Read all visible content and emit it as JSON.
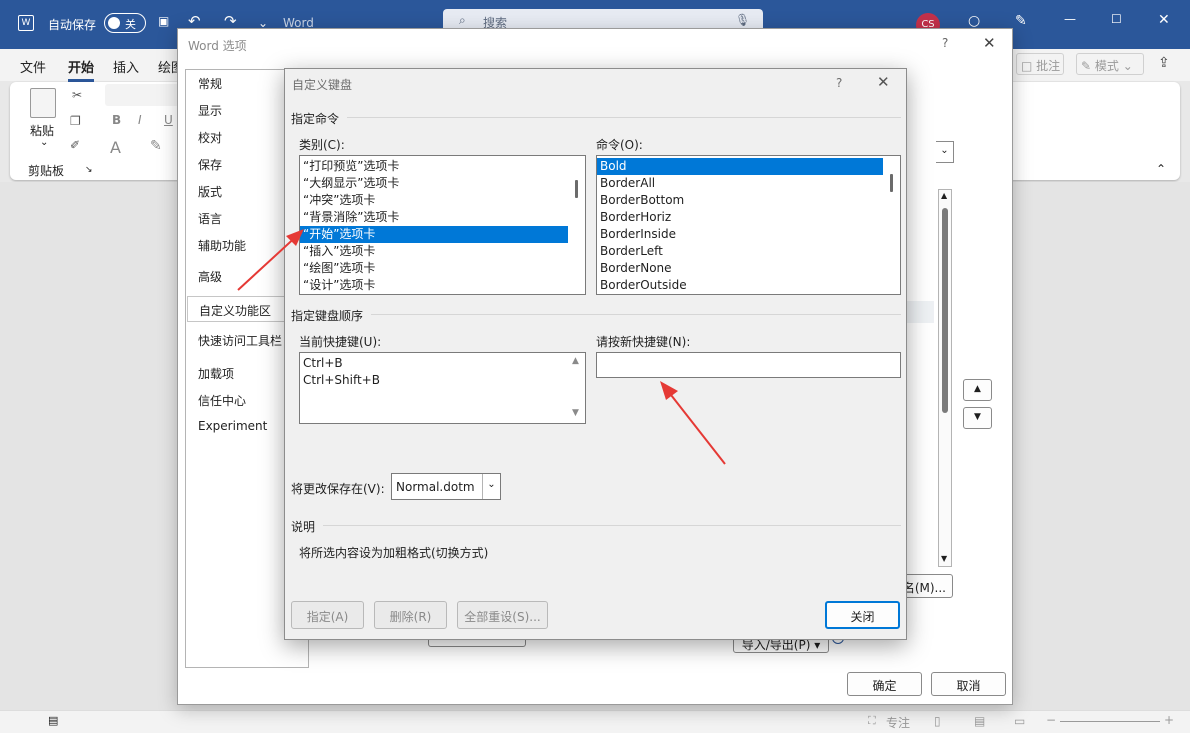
{
  "word": {
    "autosave_label": "自动保存",
    "autosave_state": "关",
    "doc_title": "Word",
    "search_placeholder": "搜索",
    "user_initials": "CS",
    "ribbon_tabs": [
      "文件",
      "开始",
      "插入",
      "绘图"
    ],
    "ribbon_right": [
      "批注",
      "模式"
    ],
    "clipboard": {
      "paste": "粘贴",
      "group": "剪贴板"
    },
    "font_buttons": [
      "B",
      "I",
      "U"
    ],
    "status_right": "专注"
  },
  "options_dialog": {
    "title": "Word 选项",
    "nav": [
      "常规",
      "显示",
      "校对",
      "保存",
      "版式",
      "语言",
      "辅助功能",
      "高级",
      "自定义功能区",
      "快速访问工具栏",
      "加载项",
      "信任中心",
      "Experiment"
    ],
    "nav_selected": "自定义功能区",
    "rename_btn": "名(M)...",
    "import_export": "导入/导出(P) ▾",
    "ok": "确定",
    "cancel": "取消"
  },
  "kb_dialog": {
    "title": "自定义键盘",
    "help": "?",
    "section_command": "指定命令",
    "category_label": "类别(C):",
    "categories": [
      "“打印预览”选项卡",
      "“大纲显示”选项卡",
      "“冲突”选项卡",
      "“背景消除”选项卡",
      "“开始”选项卡",
      "“插入”选项卡",
      "“绘图”选项卡",
      "“设计”选项卡"
    ],
    "category_selected": "“开始”选项卡",
    "command_label": "命令(O):",
    "commands": [
      "Bold",
      "BorderAll",
      "BorderBottom",
      "BorderHoriz",
      "BorderInside",
      "BorderLeft",
      "BorderNone",
      "BorderOutside"
    ],
    "command_selected": "Bold",
    "section_keys": "指定键盘顺序",
    "current_keys_label": "当前快捷键(U):",
    "current_keys": [
      "Ctrl+B",
      "Ctrl+Shift+B"
    ],
    "new_key_label": "请按新快捷键(N):",
    "new_key_value": "",
    "save_in_label": "将更改保存在(V):",
    "save_in_value": "Normal.dotm",
    "section_desc": "说明",
    "description": "将所选内容设为加粗格式(切换方式)",
    "btn_assign": "指定(A)",
    "btn_remove": "删除(R)",
    "btn_reset": "全部重设(S)...",
    "btn_close": "关闭"
  },
  "colors": {
    "accent": "#0078d7",
    "title_bar": "#2b579a",
    "annotation_arrow": "#e53935"
  }
}
